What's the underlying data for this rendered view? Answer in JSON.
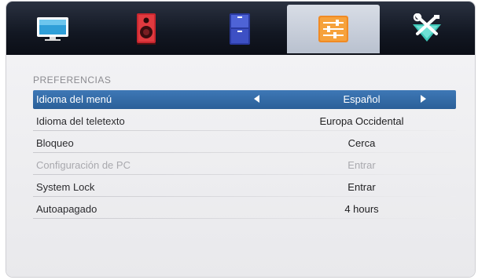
{
  "tabs": [
    {
      "icon": "tv-icon",
      "active": false
    },
    {
      "icon": "speaker-icon",
      "active": false
    },
    {
      "icon": "channel-list-icon",
      "active": false
    },
    {
      "icon": "settings-sliders-icon",
      "active": true
    },
    {
      "icon": "tools-icon",
      "active": false
    }
  ],
  "section_title": "PREFERENCIAS",
  "rows": [
    {
      "label": "Idioma del menú",
      "value": "Español",
      "selected": true,
      "disabled": false
    },
    {
      "label": "Idioma del teletexto",
      "value": "Europa Occidental",
      "selected": false,
      "disabled": false
    },
    {
      "label": "Bloqueo",
      "value": "Cerca",
      "selected": false,
      "disabled": false
    },
    {
      "label": "Configuración de PC",
      "value": "Entrar",
      "selected": false,
      "disabled": true
    },
    {
      "label": "System Lock",
      "value": "Entrar",
      "selected": false,
      "disabled": false
    },
    {
      "label": "Autoapagado",
      "value": "4 hours",
      "selected": false,
      "disabled": false
    }
  ],
  "colors": {
    "selection": "#3a72b0",
    "topbar": "#141a26",
    "active_tab": "#c9d0db"
  }
}
